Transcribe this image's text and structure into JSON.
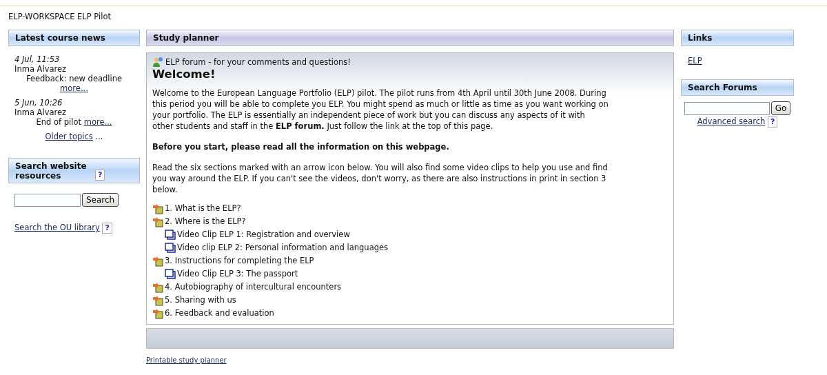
{
  "page_title": "ELP-WORKSPACE ELP Pilot",
  "news": {
    "title": "Latest course news",
    "items": [
      {
        "date": "4 Jul, 11:53",
        "author": "Inma Alvarez",
        "subject": "Feedback: new deadline",
        "more": "more..."
      },
      {
        "date": "5 Jun, 10:26",
        "author": "Inma Alvarez",
        "subject": "End of pilot",
        "more": "more..."
      }
    ],
    "older": "Older topics",
    "older_suffix": "..."
  },
  "site_search": {
    "title": "Search website resources",
    "help": "?",
    "button": "Search",
    "library_link": "Search the OU library",
    "library_help": "?"
  },
  "planner": {
    "title": "Study planner",
    "forum_link": "ELP forum - for your comments and questions!",
    "heading": "Welcome!",
    "intro": "Welcome to the European Language Portfolio (ELP) pilot. The pilot runs from 4th April until 30th June 2008. During this period you will be able to complete you ELP. You might spend as much or little as time as you want working on your portfolio. The ELP is essentially an independent piece of work but you can discuss any aspects of it with other students and staff in the **ELP forum.** Just follow the link at the top of this page.",
    "notice": "Before you start, please read all the information on this webpage.",
    "instructions": "Read the six sections marked with an arrow icon below. You will also find some video clips to help you use and find you way around the ELP. If you can't see the videos, don't worry, as there are also instructions in print in section 3 below.",
    "sections": [
      {
        "kind": "section",
        "label": "1. What is the ELP?"
      },
      {
        "kind": "section",
        "label": "2. Where is the ELP?",
        "children": [
          {
            "kind": "video",
            "label": "Video Clip ELP 1: Registration and overview"
          },
          {
            "kind": "video",
            "label": "Video clip ELP 2: Personal information and languages"
          }
        ]
      },
      {
        "kind": "section",
        "label": "3. Instructions for completing the ELP",
        "children": [
          {
            "kind": "video",
            "label": "Video Clip ELP 3: The passport"
          }
        ]
      },
      {
        "kind": "section",
        "label": "4. Autobiography of intercultural encounters"
      },
      {
        "kind": "section",
        "label": "5. Sharing with us"
      },
      {
        "kind": "section",
        "label": "6. Feedback and evaluation"
      }
    ],
    "printable": "Printable study planner"
  },
  "links": {
    "title": "Links",
    "items": [
      "ELP"
    ]
  },
  "forum_search": {
    "title": "Search Forums",
    "button": "Go",
    "advanced": "Advanced search",
    "help": "?"
  }
}
